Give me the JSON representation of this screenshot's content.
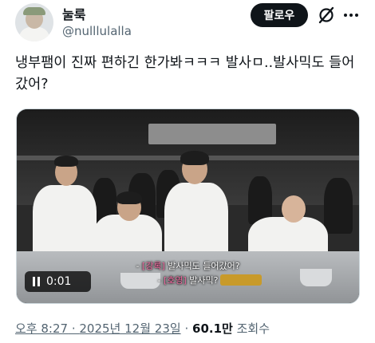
{
  "author": {
    "display_name": "눌룩",
    "handle": "@nulllulalla"
  },
  "actions": {
    "follow_label": "팔로우",
    "grok_icon": "grok-slash-icon",
    "more_icon": "more-dots-icon"
  },
  "tweet": {
    "text": "냉부팸이 진짜 편하긴 한가봐ㅋㅋㅋ 발사ㅁ..발사믹도 들어갔어?"
  },
  "video": {
    "elapsed": "0:01",
    "play_state_icon": "pause-icon",
    "subtitles": [
      {
        "speaker": "[강록]",
        "line": "발사믹도 들어갔어?"
      },
      {
        "speaker": "[호영]",
        "line": "발사믹?"
      }
    ],
    "subtitle_prefix": "-"
  },
  "meta": {
    "time": "오후 8:27",
    "date": "2025년 12월 23일",
    "views": "60.1만",
    "views_label": "조회수",
    "separator": "·"
  }
}
